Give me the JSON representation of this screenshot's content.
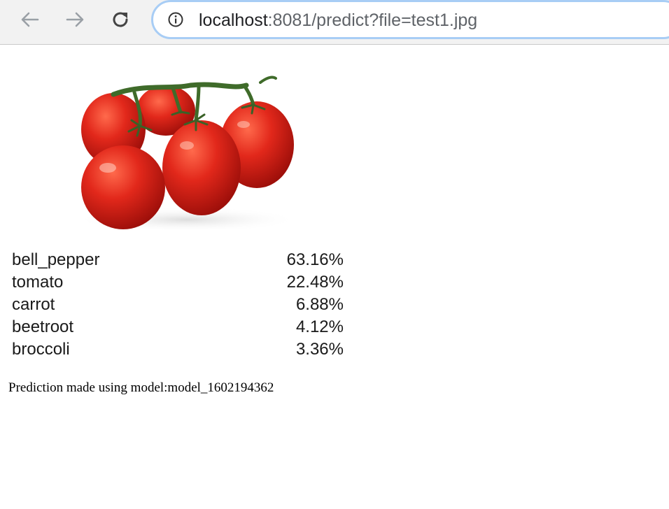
{
  "browser": {
    "url_host": "localhost",
    "url_rest": ":8081/predict?file=test1.jpg"
  },
  "predictions": [
    {
      "label": "bell_pepper",
      "probability": "63.16%"
    },
    {
      "label": "tomato",
      "probability": "22.48%"
    },
    {
      "label": "carrot",
      "probability": "6.88%"
    },
    {
      "label": "beetroot",
      "probability": "4.12%"
    },
    {
      "label": "broccoli",
      "probability": "3.36%"
    }
  ],
  "footer": {
    "model_note": "Prediction made using model:model_1602194362"
  },
  "colors": {
    "address_bar_border": "#a8cdf5",
    "toolbar_bg": "#f2f2f2",
    "tomato_red": "#d8261d",
    "vine_green": "#3f6b2a"
  }
}
